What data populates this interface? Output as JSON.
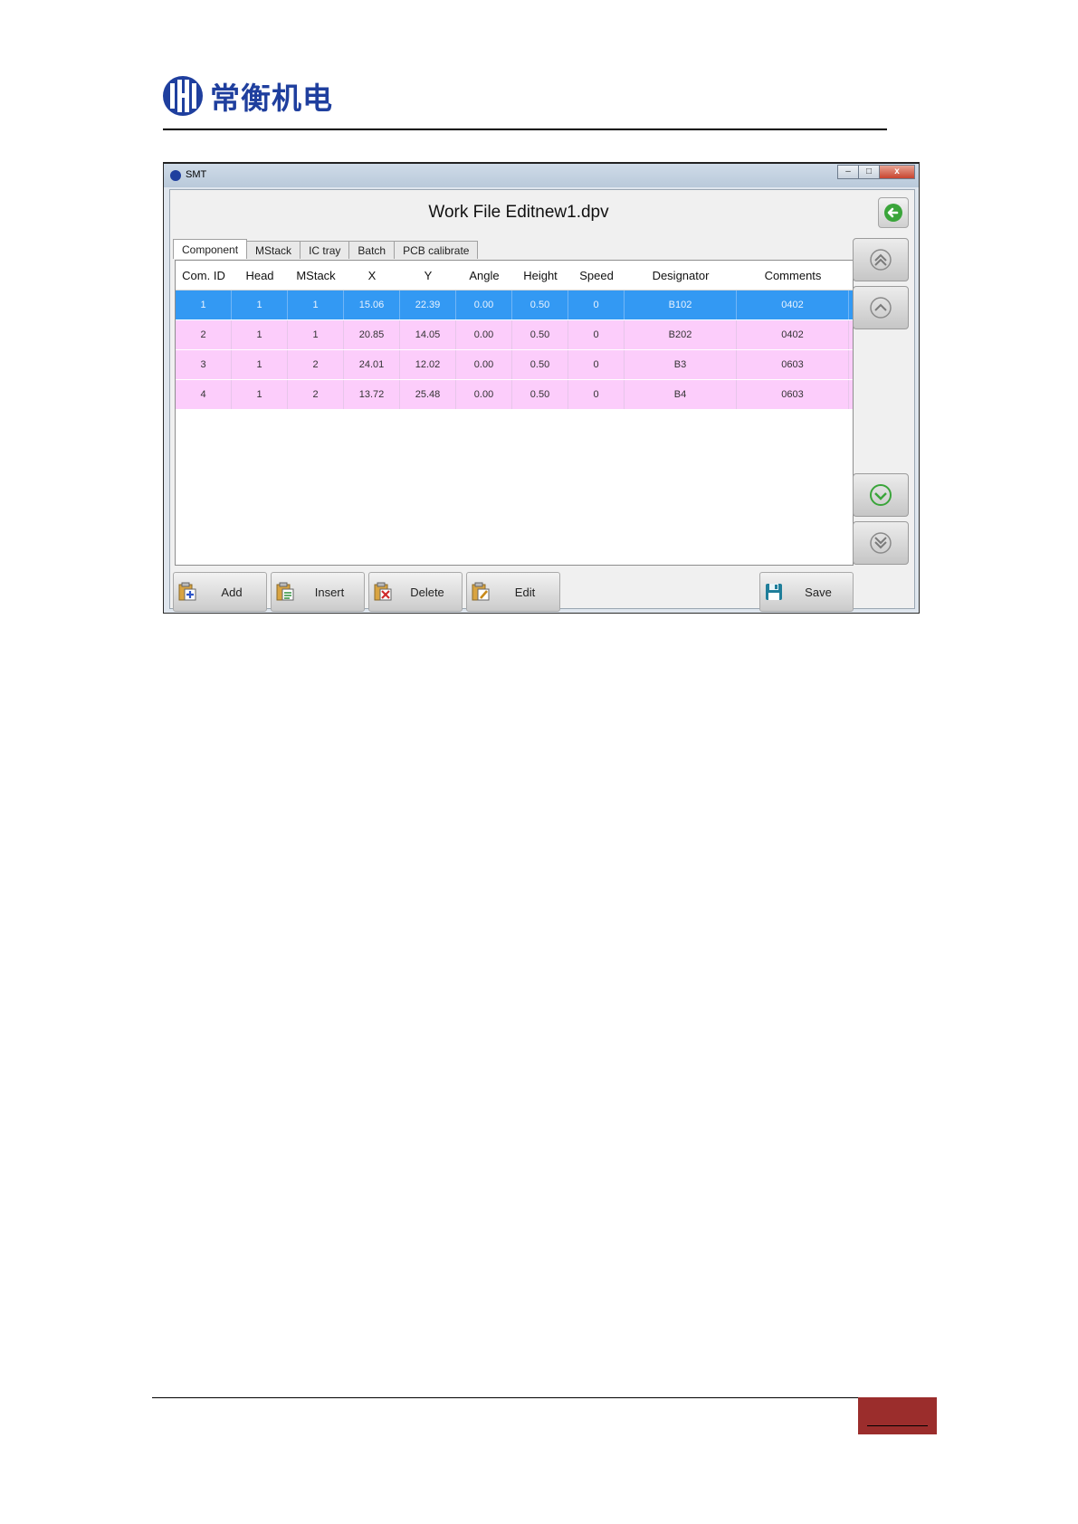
{
  "brand": {
    "logo_text": "常衡机电"
  },
  "window": {
    "title": "SMT",
    "controls": {
      "minimize": "–",
      "maximize": "□",
      "close": "x"
    },
    "form_title": "Work File Editnew1.dpv"
  },
  "tabs": [
    {
      "label": "Component",
      "active": true
    },
    {
      "label": "MStack",
      "active": false
    },
    {
      "label": "IC tray",
      "active": false
    },
    {
      "label": "Batch",
      "active": false
    },
    {
      "label": "PCB calibrate",
      "active": false
    }
  ],
  "grid": {
    "columns": [
      "Com. ID",
      "Head",
      "MStack",
      "X",
      "Y",
      "Angle",
      "Height",
      "Speed",
      "Designator",
      "Comments"
    ],
    "rows": [
      [
        "1",
        "1",
        "1",
        "15.06",
        "22.39",
        "0.00",
        "0.50",
        "0",
        "B102",
        "0402"
      ],
      [
        "2",
        "1",
        "1",
        "20.85",
        "14.05",
        "0.00",
        "0.50",
        "0",
        "B202",
        "0402"
      ],
      [
        "3",
        "1",
        "2",
        "24.01",
        "12.02",
        "0.00",
        "0.50",
        "0",
        "B3",
        "0603"
      ],
      [
        "4",
        "1",
        "2",
        "13.72",
        "25.48",
        "0.00",
        "0.50",
        "0",
        "B4",
        "0603"
      ]
    ],
    "selected_row": 0
  },
  "toolbar": {
    "add": "Add",
    "insert": "Insert",
    "delete": "Delete",
    "edit": "Edit",
    "save": "Save"
  },
  "colors": {
    "selected_row": "#3399f3",
    "normal_row": "#fccdfb",
    "accent_green": "#3aa53a",
    "brand_blue": "#1f3f9e",
    "footer_red": "#9b2d2c"
  }
}
